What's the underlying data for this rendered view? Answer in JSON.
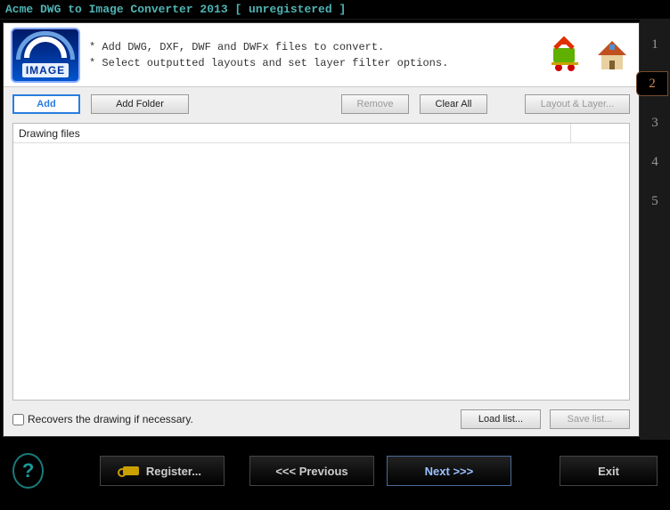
{
  "window": {
    "title": "Acme DWG to Image Converter 2013 [ unregistered ]"
  },
  "logo": {
    "text": "IMAGE"
  },
  "hints": {
    "line1": "* Add DWG, DXF, DWF and DWFx files to convert.",
    "line2": "* Select outputted layouts and set layer filter options."
  },
  "toolbar": {
    "add": "Add",
    "add_folder": "Add Folder",
    "remove": "Remove",
    "clear_all": "Clear All",
    "layout_layer": "Layout & Layer..."
  },
  "table": {
    "col1": "Drawing files"
  },
  "below": {
    "recover_label": "Recovers the drawing if necessary.",
    "load_list": "Load list...",
    "save_list": "Save list..."
  },
  "steps": {
    "s1": "1",
    "s2": "2",
    "s3": "3",
    "s4": "4",
    "s5": "5"
  },
  "footer": {
    "help": "?",
    "register": "Register...",
    "previous": "<<<  Previous",
    "next": "Next  >>>",
    "exit": "Exit"
  }
}
